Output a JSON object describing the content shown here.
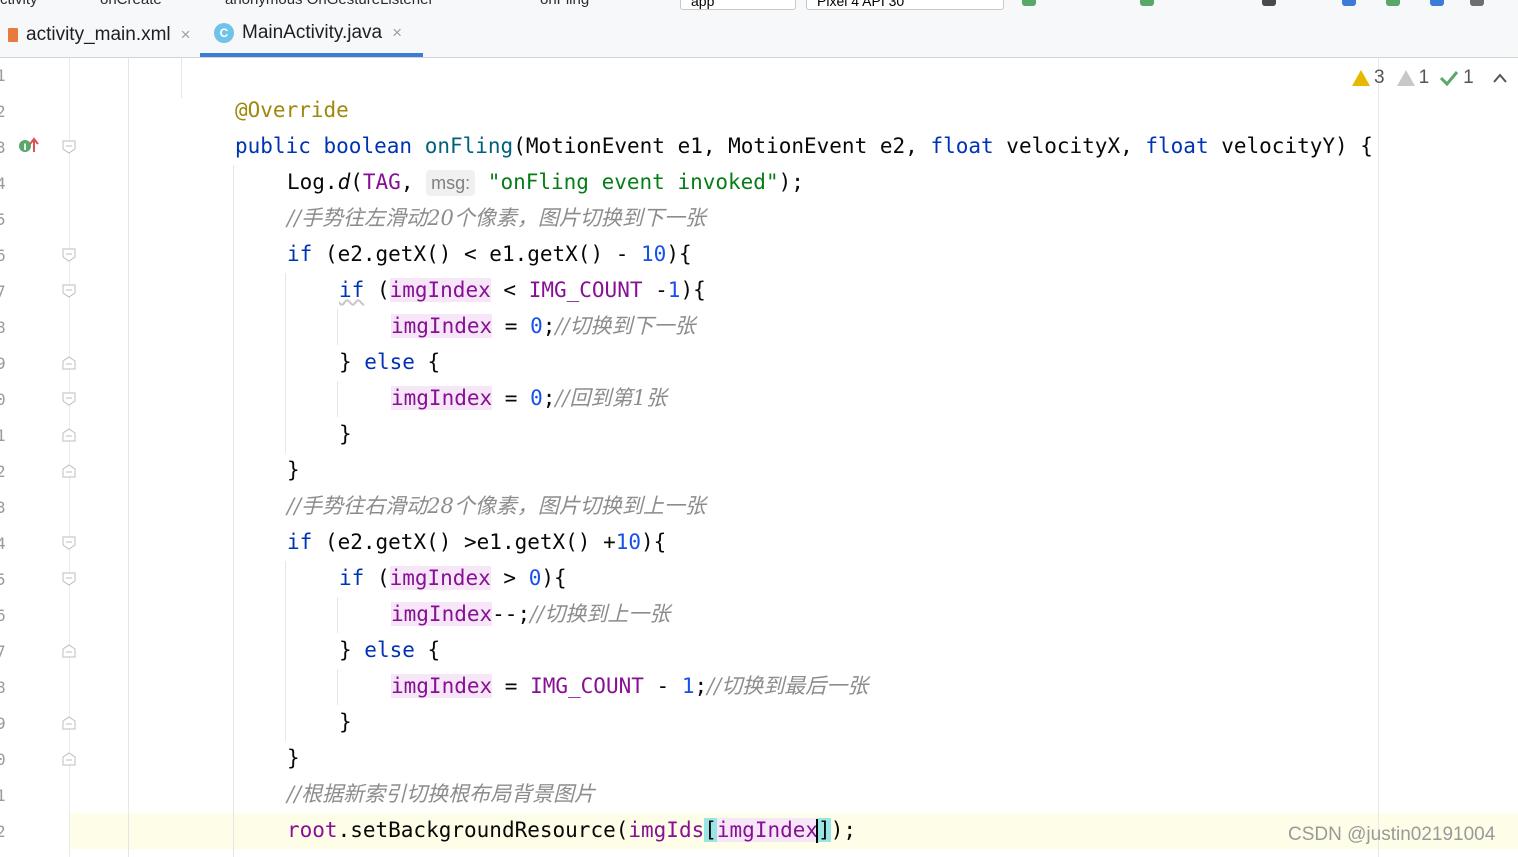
{
  "topbar": {
    "crumbs": [
      "ctivity",
      "onCreate",
      "anonymous OnGestureListener",
      "onFling"
    ],
    "run_config": "app",
    "device": "Pixel 4 API 30"
  },
  "tabs": [
    {
      "label": "activity_main.xml",
      "close": "×",
      "active": false
    },
    {
      "label": "MainActivity.java",
      "close": "×",
      "active": true
    }
  ],
  "inspections": {
    "warnings": "3",
    "weak_warnings": "1",
    "ok": "1"
  },
  "gutter": {
    "line_numbers": [
      "1",
      "2",
      "3",
      "4",
      "5",
      "6",
      "7",
      "8",
      "9",
      "0",
      "1",
      "2",
      "3",
      "4",
      "5",
      "6",
      "7",
      "8",
      "9",
      "0",
      "1",
      "2"
    ],
    "override_marker": "I"
  },
  "code": {
    "annotation": "@Override",
    "sig_public": "public",
    "sig_boolean": "boolean",
    "sig_name": "onFling",
    "sig_params_1": "(MotionEvent e1, MotionEvent e2, ",
    "sig_float1": "float",
    "sig_params_2": " velocityX, ",
    "sig_float2": "float",
    "sig_params_3": " velocityY) {",
    "log_prefix": "Log.",
    "log_method": "d",
    "log_open": "(",
    "log_tag": "TAG",
    "log_comma": ", ",
    "log_hint": "msg:",
    "log_string": "\"onFling event invoked\"",
    "log_close": ");",
    "comment_left": "//手势往左滑动20个像素，图片切换到下一张",
    "if1_kw": "if",
    "if1_cond_a": " (e2.getX() < e1.getX() - ",
    "if1_num": "10",
    "if1_cond_b": "){",
    "if2_kw": "if",
    "if2_open": " (",
    "var": "imgIndex",
    "if2_op": " < ",
    "img_count": "IMG_COUNT",
    "if2_minus": " -",
    "one": "1",
    "if2_close": "){",
    "assign_eq": " = ",
    "zero": "0",
    "semi": ";",
    "comment_next": "//切换到下一张",
    "else_pre": "} ",
    "else_kw": "else",
    "else_post": " {",
    "comment_first": "//回到第1张",
    "brace_close": "}",
    "comment_right": "//手势往右滑动28个像素，图片切换到上一张",
    "if3_kw": "if",
    "if3_cond_a": " (e2.getX() >e1.getX() +",
    "if3_num": "10",
    "if3_cond_b": "){",
    "if4_kw": "if",
    "if4_open": " (",
    "if4_op": " > ",
    "if4_close": "){",
    "decrement": "--;",
    "comment_prev": "//切换到上一张",
    "assign_minus": " - ",
    "comment_last": "//切换到最后一张",
    "comment_switch": "//根据新索引切换根布局背景图片",
    "root_field": "root",
    "root_call": ".setBackgroundResource(",
    "ids_field": "imgIds",
    "bracket_open": "[",
    "bracket_close": "]",
    "call_end": ");"
  },
  "watermark": "CSDN @justin02191004"
}
